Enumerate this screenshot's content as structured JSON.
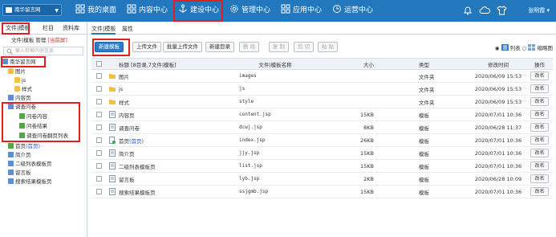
{
  "topbar": {
    "site": "南华留言网",
    "nav": [
      "我的桌面",
      "内容中心",
      "建设中心",
      "管理中心",
      "应用中心",
      "运营中心"
    ],
    "user": "张明霞",
    "bg": "#2277bd"
  },
  "left": {
    "tabs": [
      "文件|模板",
      "栏目",
      "资料库"
    ],
    "tool_label": "文件|模板",
    "tool_manage": "管理",
    "tool_current": "[当前屏]",
    "search_placeholder": "输入检索内容信息",
    "root": "南华留言网",
    "tree": [
      "图片",
      "js",
      "样式",
      "内容页",
      "调查问卷",
      "问卷内容",
      "问卷结果",
      "调查问卷翻页列表",
      "首页",
      "(首页)",
      "简介页",
      "二级列表模板页",
      "留言板",
      "搜索结果模板页"
    ]
  },
  "main": {
    "tabs": [
      "文件|模板",
      "属性"
    ],
    "buttons": [
      "新建模板",
      "上传文件",
      "批量上传文件",
      "新建目录",
      "删 除",
      "复 制",
      "剪 切",
      "粘 贴"
    ],
    "view_list": "列表",
    "view_thumb": "缩略图",
    "columns": [
      "标题 [8目录,7文件|模板]",
      "文件|模板名称",
      "大小",
      "类型",
      "修改时间",
      "操作"
    ],
    "rename_label": "改名",
    "rows": [
      {
        "title": "图片",
        "name": "images",
        "size": "",
        "type": "文件夹",
        "time": "2020/06/09 15:53",
        "icon": "folder"
      },
      {
        "title": "js",
        "name": "js",
        "size": "",
        "type": "文件夹",
        "time": "2020/06/09 15:53",
        "icon": "folder"
      },
      {
        "title": "样式",
        "name": "style",
        "size": "",
        "type": "文件夹",
        "time": "2020/06/09 15:53",
        "icon": "folder"
      },
      {
        "title": "内容页",
        "name": "content.jsp",
        "size": "15KB",
        "type": "模板",
        "time": "2020/07/01 10:36",
        "icon": "page"
      },
      {
        "title": "调查问卷",
        "name": "dcwj.jsp",
        "size": "8KB",
        "type": "模板",
        "time": "2020/06/28 11:37",
        "icon": "page"
      },
      {
        "title": "首页",
        "title_suffix": "(首页)",
        "name": "index.jsp",
        "size": "26KB",
        "type": "模板",
        "time": "2020/07/01 10:36",
        "icon": "home"
      },
      {
        "title": "简介页",
        "name": "jjy.jsp",
        "size": "15KB",
        "type": "模板",
        "time": "2020/07/01 10:36",
        "icon": "page"
      },
      {
        "title": "二级列表模板页",
        "name": "list.jsp",
        "size": "15KB",
        "type": "模板",
        "time": "2020/07/01 10:36",
        "icon": "page"
      },
      {
        "title": "留言板",
        "name": "lyb.jsp",
        "size": "2KB",
        "type": "模板",
        "time": "2020/06/28 10:09",
        "icon": "page"
      },
      {
        "title": "搜索结果模板页",
        "name": "ssjgmb.jsp",
        "size": "15KB",
        "type": "模板",
        "time": "2020/07/01 10:36",
        "icon": "page"
      }
    ]
  }
}
